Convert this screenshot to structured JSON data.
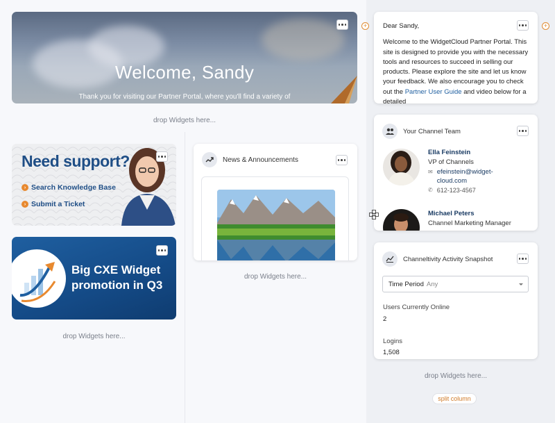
{
  "hero": {
    "title": "Welcome, Sandy",
    "subtitle": "Thank you for visiting our Partner Portal, where you'll find a variety of"
  },
  "drop_label": "drop Widgets here...",
  "support_widget": {
    "title": "Need support?",
    "link_search": "Search Knowledge Base",
    "link_ticket": "Submit a Ticket"
  },
  "promo_widget": {
    "line1": "Big CXE Widget",
    "line2": "promotion in Q3"
  },
  "news": {
    "title": "News & Announcements"
  },
  "letter": {
    "greeting": "Dear Sandy,",
    "body_before_link": "Welcome to the WidgetCloud Partner Portal. This site is designed to provide you with the necessary tools and resources to succeed in selling our products. Please explore the site and let us know your feedback. We also encourage you to check out the",
    "link_text": "Partner User Guide",
    "body_after_link": "and video below for a detailed"
  },
  "team": {
    "title": "Your Channel Team",
    "members": [
      {
        "name": "Ella Feinstein",
        "role": "VP of Channels",
        "email": "efeinstein@widget-cloud.com",
        "phone": "612-123-4567"
      },
      {
        "name": "Michael Peters",
        "role": "Channel Marketing Manager"
      }
    ]
  },
  "snapshot": {
    "title": "Channeltivity Activity Snapshot",
    "filter_label": "Time Period",
    "filter_value": "Any",
    "stats": [
      {
        "label": "Users Currently Online",
        "value": "2"
      },
      {
        "label": "Logins",
        "value": "1,508"
      }
    ]
  },
  "split_column_label": "split column",
  "colors": {
    "accent_orange": "#e8892f",
    "brand_blue": "#1f4e86",
    "link_blue": "#1f5fa0"
  }
}
